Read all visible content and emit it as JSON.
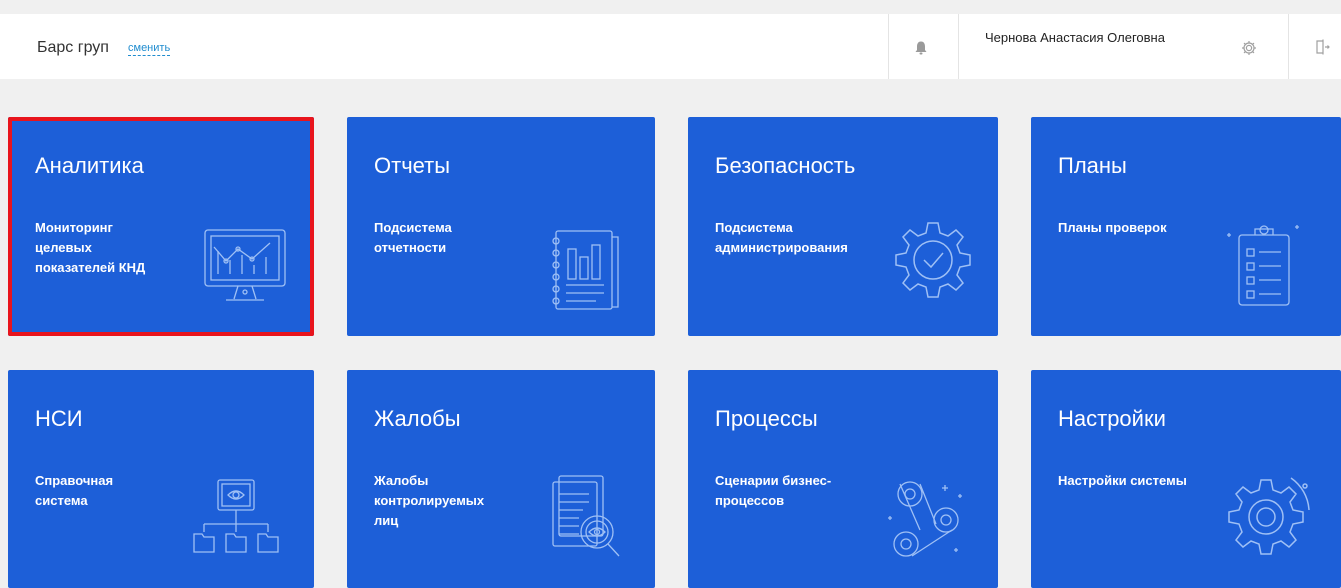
{
  "header": {
    "organization": "Барс груп",
    "change_label": "сменить",
    "user_name": "Чернова Анастасия Олеговна",
    "icons": {
      "notifications": "bell-icon",
      "settings": "gear-icon",
      "logout": "logout-icon"
    }
  },
  "colors": {
    "tile": "#1d5fd8",
    "selection": "#e8141c",
    "link": "#1f8ccf"
  },
  "tiles": [
    {
      "title": "Аналитика",
      "subtitle": [
        "Мониторинг",
        "целевых",
        "показателей КНД"
      ],
      "icon": "monitor-chart-icon",
      "selected": true
    },
    {
      "title": "Отчеты",
      "subtitle": [
        "Подсистема",
        "отчетности"
      ],
      "icon": "report-notebook-icon",
      "selected": false
    },
    {
      "title": "Безопасность",
      "subtitle": [
        "Подсистема",
        "администрирования"
      ],
      "icon": "gear-check-icon",
      "selected": false
    },
    {
      "title": "Планы",
      "subtitle": [
        "Планы проверок"
      ],
      "icon": "clipboard-list-icon",
      "selected": false
    },
    {
      "title": "НСИ",
      "subtitle": [
        "Справочная",
        "система"
      ],
      "icon": "hierarchy-screen-icon",
      "selected": false
    },
    {
      "title": "Жалобы",
      "subtitle": [
        "Жалобы",
        "контролируемых",
        "лиц"
      ],
      "icon": "document-magnifier-icon",
      "selected": false
    },
    {
      "title": "Процессы",
      "subtitle": [
        "Сценарии бизнес-",
        "процессов"
      ],
      "icon": "gears-process-icon",
      "selected": false
    },
    {
      "title": "Настройки",
      "subtitle": [
        "Настройки системы"
      ],
      "icon": "settings-gear-icon",
      "selected": false
    }
  ]
}
